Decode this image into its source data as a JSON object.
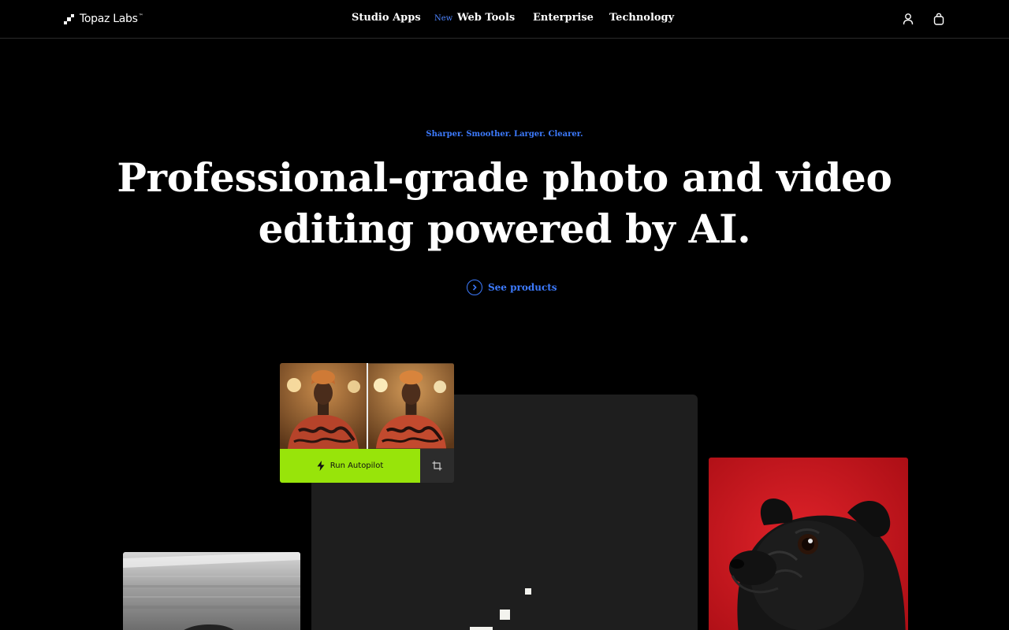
{
  "header": {
    "logo_text": "Topaz Labs",
    "logo_tm": "™",
    "nav": [
      {
        "label": "Studio Apps"
      },
      {
        "label": "Web Tools",
        "badge": "New"
      },
      {
        "label": "Enterprise"
      },
      {
        "label": "Technology"
      }
    ],
    "icons": {
      "account": "user-icon",
      "cart": "bag-icon"
    }
  },
  "hero": {
    "tagline": "Sharper. Smoother. Larger. Clearer.",
    "headline": "Professional-grade photo and video editing powered by AI.",
    "cta_label": "See products",
    "cta_icon": "chevron-right-circle-icon"
  },
  "collage": {
    "autopilot_label": "Run Autopilot",
    "autopilot_icon": "lightning-icon",
    "crop_icon": "crop-icon"
  },
  "colors": {
    "accent_blue": "#3d7bff",
    "autopilot_green": "#98e40a",
    "pug_background": "#d3131c",
    "panel": "#1e1e1e"
  }
}
